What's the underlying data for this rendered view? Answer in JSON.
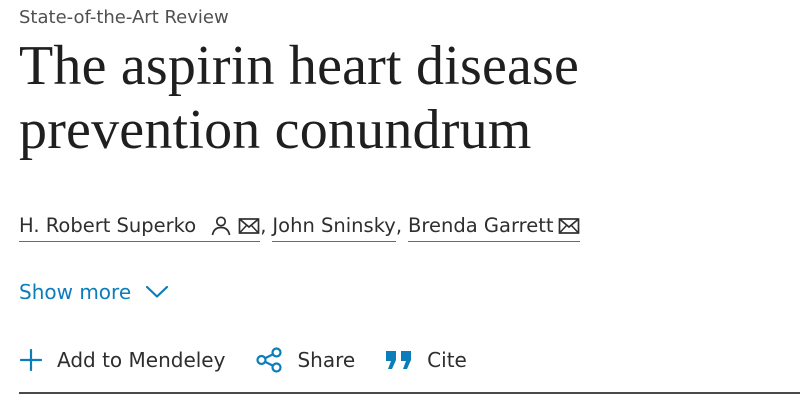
{
  "article": {
    "type_label": "State-of-the-Art Review",
    "title": "The aspirin heart disease prevention conundrum"
  },
  "authors": [
    {
      "name": "H. Robert Superko",
      "icons": [
        "person-icon",
        "envelope-icon"
      ]
    },
    {
      "name": "John Sninsky",
      "icons": []
    },
    {
      "name": "Brenda Garrett",
      "icons": [
        "envelope-icon"
      ]
    }
  ],
  "author_separator": ",",
  "show_more": {
    "label": "Show more"
  },
  "toolbar": {
    "mendeley_label": "Add to Mendeley",
    "share_label": "Share",
    "cite_label": "Cite"
  },
  "colors": {
    "link_blue": "#0c7dbb",
    "text": "#1f1f1f",
    "muted": "#505050"
  }
}
